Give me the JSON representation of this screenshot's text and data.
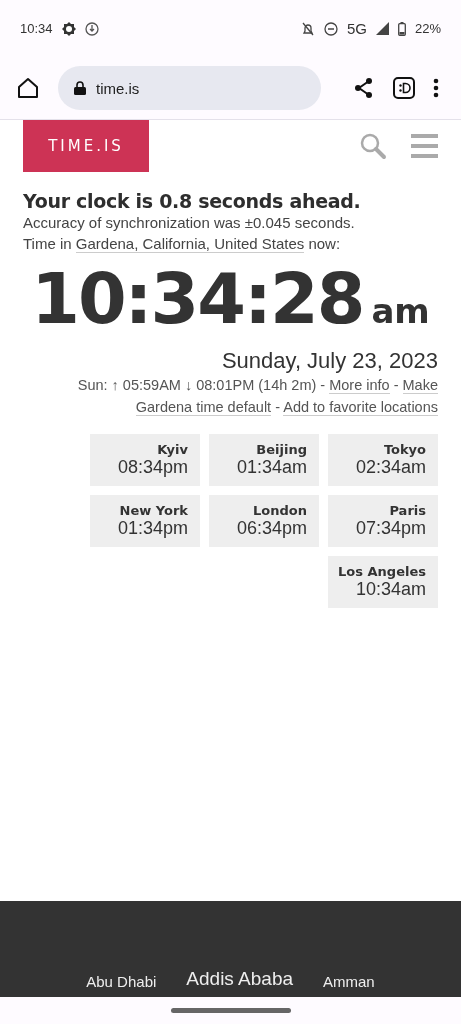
{
  "status_bar": {
    "time": "10:34",
    "network": "5G",
    "battery": "22%"
  },
  "browser": {
    "url": "time.is"
  },
  "site": {
    "logo": "TIME.IS"
  },
  "headline": "Your clock is 0.8 seconds ahead.",
  "accuracy": "Accuracy of synchronization was ±0.045 seconds.",
  "location": {
    "before": "Time in ",
    "link": "Gardena, California, United States",
    "after": " now:"
  },
  "clock": {
    "time": "10:34:28",
    "ampm": "am"
  },
  "date": "Sunday, July 23, 2023",
  "sun_lines": [
    [
      {
        "kind": "text",
        "text": "Sun: ↑ 05:59AM ↓ 08:01PM (14h 2m) - "
      },
      {
        "kind": "link",
        "text": "More info"
      },
      {
        "kind": "text",
        "text": " - "
      },
      {
        "kind": "link",
        "text": "Make"
      }
    ],
    [
      {
        "kind": "link",
        "text": "Gardena time default"
      },
      {
        "kind": "text",
        "text": " - "
      },
      {
        "kind": "link",
        "text": "Add to favorite locations"
      }
    ]
  ],
  "cities": [
    {
      "name": "Kyiv",
      "time": "08:34pm"
    },
    {
      "name": "Beijing",
      "time": "01:34am"
    },
    {
      "name": "Tokyo",
      "time": "02:34am"
    },
    {
      "name": "New York",
      "time": "01:34pm"
    },
    {
      "name": "London",
      "time": "06:34pm"
    },
    {
      "name": "Paris",
      "time": "07:34pm"
    },
    {
      "name": "Los Angeles",
      "time": "10:34am"
    }
  ],
  "footer_links": [
    {
      "text": "Abu Dhabi",
      "kind": "small"
    },
    {
      "text": "Addis Ababa",
      "kind": "large"
    },
    {
      "text": "Amman",
      "kind": "small"
    }
  ]
}
